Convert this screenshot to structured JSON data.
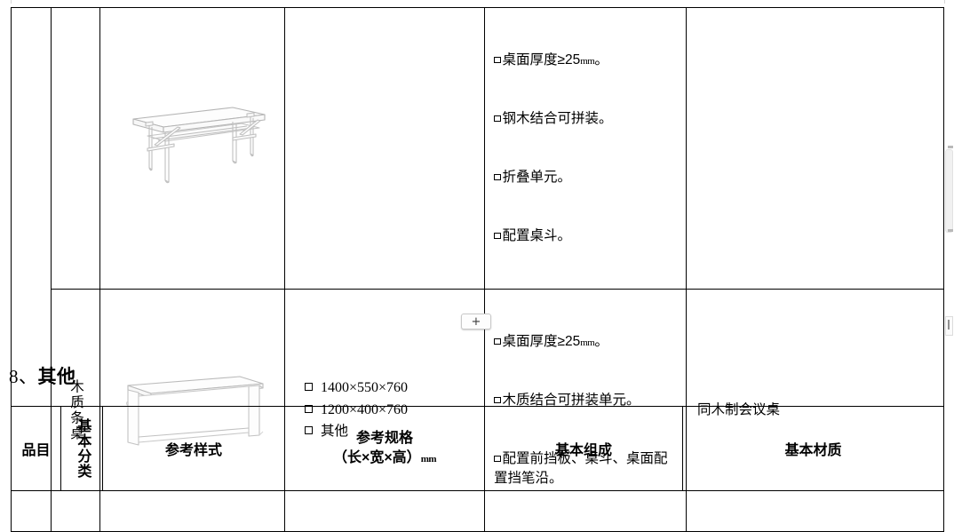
{
  "document": {
    "section_heading": {
      "number": "8、",
      "title": "其他"
    }
  },
  "table_top": {
    "rows": [
      {
        "category": "",
        "illustration": "folding-steel-wood-table-drawing",
        "specs": [],
        "composition": [
          "□桌面厚度≥25mm。",
          "□钢木结合可拼装。",
          "□折叠单元。",
          "□配置桌斗。"
        ],
        "composition_lines": "□桌面厚度≥25mm。\n□钢木结合可拼装。\n□折叠单元。\n□配置桌斗。",
        "material": ""
      },
      {
        "category": "木质条桌",
        "illustration": "wooden-bar-desk-drawing",
        "specs": [
          "1400×550×760",
          "1200×400×760",
          "其他"
        ],
        "composition_line_1": "□桌面厚度≥25",
        "composition_line_1_unit": "mm",
        "composition_line_1_end": "。",
        "composition_line_2": "□木质结合可拼装单元。",
        "composition_line_3": "□配置前挡板、桌斗、桌面配置挡笔沿。",
        "material": "同木制会议桌"
      }
    ],
    "row1_composition_line_1_prefix": "桌面厚度≥25",
    "row1_composition_line_1_unit": "mm",
    "row1_composition_line_1_suffix": "。",
    "row1_composition_line_2": "钢木结合可拼装。",
    "row1_composition_line_3": "折叠单元。",
    "row1_composition_line_4": "配置桌斗。",
    "row2_composition_line_1_prefix": "桌面厚度≥25",
    "row2_composition_line_1_unit": "mm",
    "row2_composition_line_1_suffix": "。",
    "row2_composition_line_2": "木质结合可拼装单元。",
    "row2_composition_line_3": "配置前挡板、桌斗、桌面配置挡笔沿。"
  },
  "table_bottom": {
    "headers": [
      "品目",
      "基本分类",
      "参考样式",
      "参考规格",
      "基本组成",
      "基本材质"
    ],
    "spec_header_line_1": "参考规格",
    "spec_header_line_2": "（长×宽×高）",
    "spec_header_unit": "mm"
  },
  "controls": {
    "insert_row_label": "+"
  },
  "colors": {
    "border": "#000000",
    "text": "#000000",
    "background": "#ffffff",
    "control_border": "#c8c8c8"
  }
}
